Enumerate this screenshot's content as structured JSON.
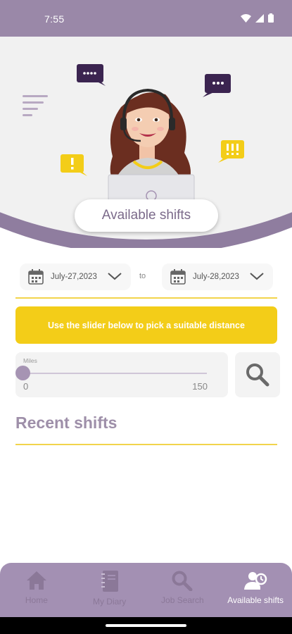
{
  "status_bar": {
    "time": "7:55"
  },
  "header": {
    "title": "Available shifts"
  },
  "dates": {
    "from": "July-27,2023",
    "separator": "to",
    "to": "July-28,2023"
  },
  "hint": {
    "text": "Use the slider below to pick a suitable distance"
  },
  "slider": {
    "label": "Miles",
    "min": "0",
    "max": "150",
    "value": 0
  },
  "recent": {
    "title": "Recent shifts"
  },
  "nav": {
    "items": [
      {
        "label": "Home",
        "icon": "home-icon",
        "active": false
      },
      {
        "label": "My Diary",
        "icon": "diary-icon",
        "active": false
      },
      {
        "label": "Job Search",
        "icon": "search-icon",
        "active": false
      },
      {
        "label": "Available shifts",
        "icon": "available-shifts-icon",
        "active": true
      }
    ]
  },
  "colors": {
    "brand_purple": "#9a88a8",
    "accent_yellow": "#f3cd18",
    "background": "#ffffff"
  }
}
